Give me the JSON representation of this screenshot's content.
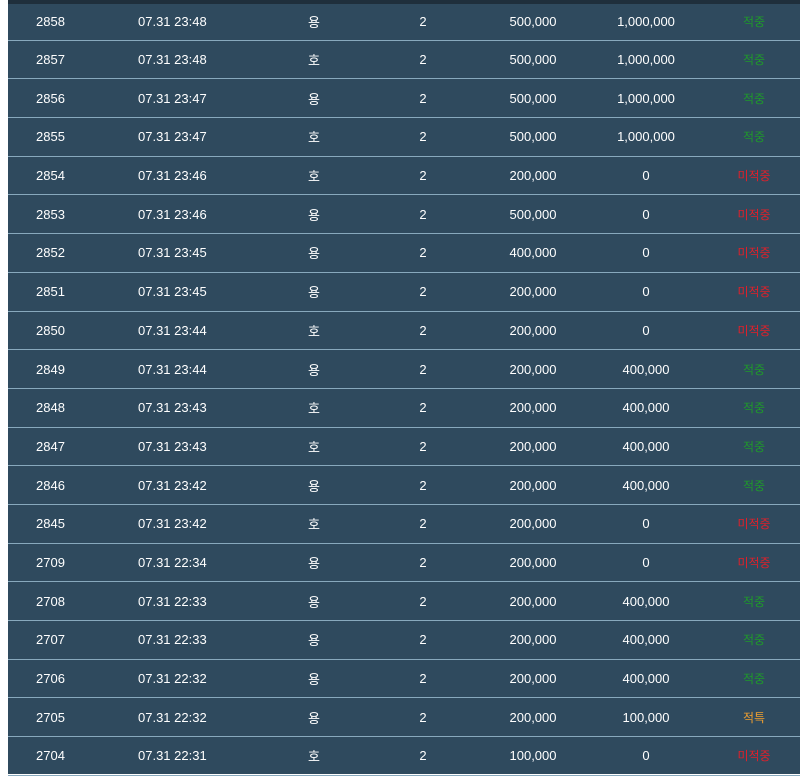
{
  "rows": [
    {
      "id": "2858",
      "time": "07.31 23:48",
      "side": "용",
      "count": "2",
      "bet": "500,000",
      "win": "1,000,000",
      "status": "적중",
      "status_type": "win"
    },
    {
      "id": "2857",
      "time": "07.31 23:48",
      "side": "호",
      "count": "2",
      "bet": "500,000",
      "win": "1,000,000",
      "status": "적중",
      "status_type": "win"
    },
    {
      "id": "2856",
      "time": "07.31 23:47",
      "side": "용",
      "count": "2",
      "bet": "500,000",
      "win": "1,000,000",
      "status": "적중",
      "status_type": "win"
    },
    {
      "id": "2855",
      "time": "07.31 23:47",
      "side": "호",
      "count": "2",
      "bet": "500,000",
      "win": "1,000,000",
      "status": "적중",
      "status_type": "win"
    },
    {
      "id": "2854",
      "time": "07.31 23:46",
      "side": "호",
      "count": "2",
      "bet": "200,000",
      "win": "0",
      "status": "미적중",
      "status_type": "lose"
    },
    {
      "id": "2853",
      "time": "07.31 23:46",
      "side": "용",
      "count": "2",
      "bet": "500,000",
      "win": "0",
      "status": "미적중",
      "status_type": "lose"
    },
    {
      "id": "2852",
      "time": "07.31 23:45",
      "side": "용",
      "count": "2",
      "bet": "400,000",
      "win": "0",
      "status": "미적중",
      "status_type": "lose"
    },
    {
      "id": "2851",
      "time": "07.31 23:45",
      "side": "용",
      "count": "2",
      "bet": "200,000",
      "win": "0",
      "status": "미적중",
      "status_type": "lose"
    },
    {
      "id": "2850",
      "time": "07.31 23:44",
      "side": "호",
      "count": "2",
      "bet": "200,000",
      "win": "0",
      "status": "미적중",
      "status_type": "lose"
    },
    {
      "id": "2849",
      "time": "07.31 23:44",
      "side": "용",
      "count": "2",
      "bet": "200,000",
      "win": "400,000",
      "status": "적중",
      "status_type": "win"
    },
    {
      "id": "2848",
      "time": "07.31 23:43",
      "side": "호",
      "count": "2",
      "bet": "200,000",
      "win": "400,000",
      "status": "적중",
      "status_type": "win"
    },
    {
      "id": "2847",
      "time": "07.31 23:43",
      "side": "호",
      "count": "2",
      "bet": "200,000",
      "win": "400,000",
      "status": "적중",
      "status_type": "win"
    },
    {
      "id": "2846",
      "time": "07.31 23:42",
      "side": "용",
      "count": "2",
      "bet": "200,000",
      "win": "400,000",
      "status": "적중",
      "status_type": "win"
    },
    {
      "id": "2845",
      "time": "07.31 23:42",
      "side": "호",
      "count": "2",
      "bet": "200,000",
      "win": "0",
      "status": "미적중",
      "status_type": "lose"
    },
    {
      "id": "2709",
      "time": "07.31 22:34",
      "side": "용",
      "count": "2",
      "bet": "200,000",
      "win": "0",
      "status": "미적중",
      "status_type": "lose"
    },
    {
      "id": "2708",
      "time": "07.31 22:33",
      "side": "용",
      "count": "2",
      "bet": "200,000",
      "win": "400,000",
      "status": "적중",
      "status_type": "win"
    },
    {
      "id": "2707",
      "time": "07.31 22:33",
      "side": "용",
      "count": "2",
      "bet": "200,000",
      "win": "400,000",
      "status": "적중",
      "status_type": "win"
    },
    {
      "id": "2706",
      "time": "07.31 22:32",
      "side": "용",
      "count": "2",
      "bet": "200,000",
      "win": "400,000",
      "status": "적중",
      "status_type": "win"
    },
    {
      "id": "2705",
      "time": "07.31 22:32",
      "side": "용",
      "count": "2",
      "bet": "200,000",
      "win": "100,000",
      "status": "적특",
      "status_type": "hit"
    },
    {
      "id": "2704",
      "time": "07.31 22:31",
      "side": "호",
      "count": "2",
      "bet": "100,000",
      "win": "0",
      "status": "미적중",
      "status_type": "lose"
    }
  ],
  "colors": {
    "background": "#2f4a5e",
    "divider": "#88a9bd",
    "win": "#1f9a2a",
    "lose": "#e0202a",
    "hit": "#f0a030"
  }
}
